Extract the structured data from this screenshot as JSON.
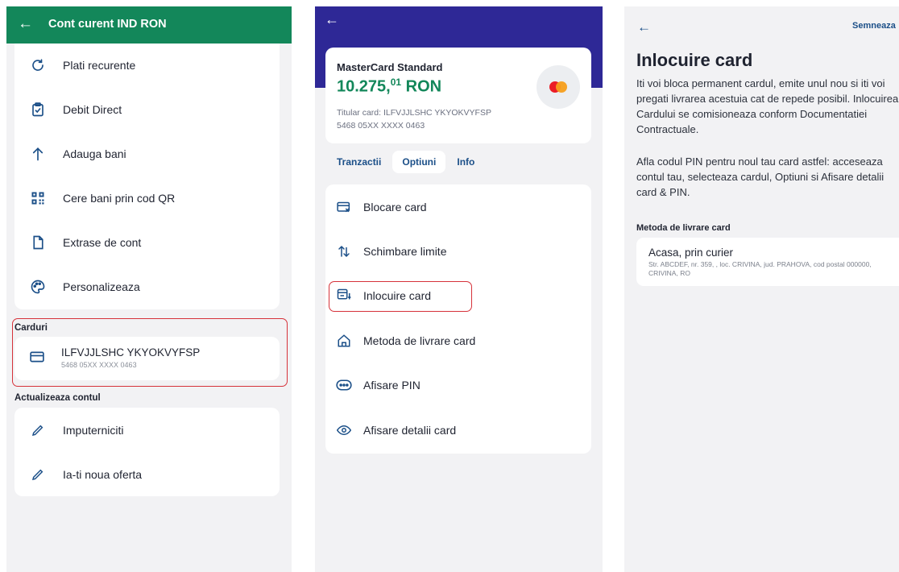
{
  "screen1": {
    "header": {
      "back_icon": "arrow-left-icon",
      "title": "Cont curent IND RON"
    },
    "menu": [
      {
        "label": "Plati recurente",
        "icon": "refresh-icon"
      },
      {
        "label": "Debit Direct",
        "icon": "clipboard-check-icon"
      },
      {
        "label": "Adauga bani",
        "icon": "arrow-up-icon"
      },
      {
        "label": "Cere bani prin cod QR",
        "icon": "qr-code-icon"
      },
      {
        "label": "Extrase de cont",
        "icon": "document-icon"
      },
      {
        "label": "Personalizeaza",
        "icon": "palette-icon"
      }
    ],
    "cards_section": "Carduri",
    "card_item": {
      "name": "ILFVJJLSHC YKYOKVYFSP",
      "number": "5468 05XX XXXX 0463",
      "icon": "credit-card-icon"
    },
    "update_section": "Actualizeaza contul",
    "update_items": [
      {
        "label": "Imputerniciti",
        "icon": "pencil-icon"
      },
      {
        "label": "Ia-ti noua oferta",
        "icon": "pencil-icon"
      }
    ],
    "highlight_color": "#d6323a",
    "header_color": "#13875a"
  },
  "screen2": {
    "back_icon": "arrow-left-icon",
    "card": {
      "name": "MasterCard Standard",
      "amount_main": "10.275,",
      "amount_decimals": "01",
      "amount_currency": " RON",
      "holder": "Titular card: ILFVJJLSHC YKYOKVYFSP",
      "number": "5468 05XX XXXX 0463",
      "logo_icon": "mastercard-logo-icon"
    },
    "tabs": [
      "Tranzactii",
      "Optiuni",
      "Info"
    ],
    "active_tab": "Optiuni",
    "options": [
      {
        "label": "Blocare card",
        "icon": "card-block-icon"
      },
      {
        "label": "Schimbare limite",
        "icon": "arrows-up-down-icon"
      },
      {
        "label": "Inlocuire card",
        "icon": "card-replace-icon"
      },
      {
        "label": "Metoda de livrare card",
        "icon": "home-icon"
      },
      {
        "label": "Afisare PIN",
        "icon": "pin-dots-icon"
      },
      {
        "label": "Afisare detalii card",
        "icon": "eye-icon"
      }
    ],
    "header_color": "#2e2896",
    "amount_color": "#13875a"
  },
  "screen3": {
    "back_icon": "arrow-left-icon",
    "sign_label": "Semneaza",
    "title": "Inlocuire card",
    "paragraph1": "Iti voi bloca permanent cardul, emite unul nou si iti voi pregati livrarea acestuia cat de repede posibil. Inlocuirea Cardului se comisioneaza conform Documentatiei Contractuale.",
    "paragraph2": "Afla codul PIN pentru noul tau card astfel: acceseaza contul tau, selecteaza cardul, Optiuni si Afisare detalii card & PIN.",
    "delivery_label": "Metoda de livrare card",
    "delivery": {
      "title": "Acasa, prin curier",
      "address": "Str. ABCDEF, nr. 359, , loc. CRIVINA, jud. PRAHOVA, cod postal 000000, CRIVINA, RO"
    }
  }
}
